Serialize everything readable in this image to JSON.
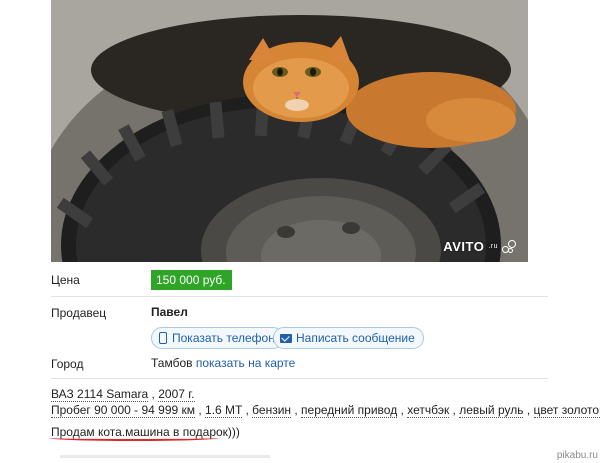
{
  "photo": {
    "watermark": "AVITO",
    "watermark_suffix": ".ru"
  },
  "listing": {
    "price_label": "Цена",
    "price_value": "150 000 руб.",
    "seller_label": "Продавец",
    "seller_name": "Павел",
    "show_phone_label": "Показать телефон",
    "write_message_label": "Написать сообщение",
    "city_label": "Город",
    "city_name": "Тамбов",
    "map_link": "показать на карте"
  },
  "description": {
    "model": "ВАЗ 2114 Samara",
    "year": "2007 г.",
    "mileage": "Пробег 90 000 - 94 999 км",
    "engine": "1.6 MT",
    "fuel": "бензин",
    "drive": "передний привод",
    "body": "хетчбэк",
    "wheel": "левый руль",
    "color": "цвет золотой",
    "note": "Продам кота.машина в подарок)))"
  },
  "footer": {
    "site": "pikabu.ru"
  },
  "colors": {
    "price_badge": "#2ea526",
    "link": "#1f5fad",
    "highlight_underline": "#e0242a"
  }
}
